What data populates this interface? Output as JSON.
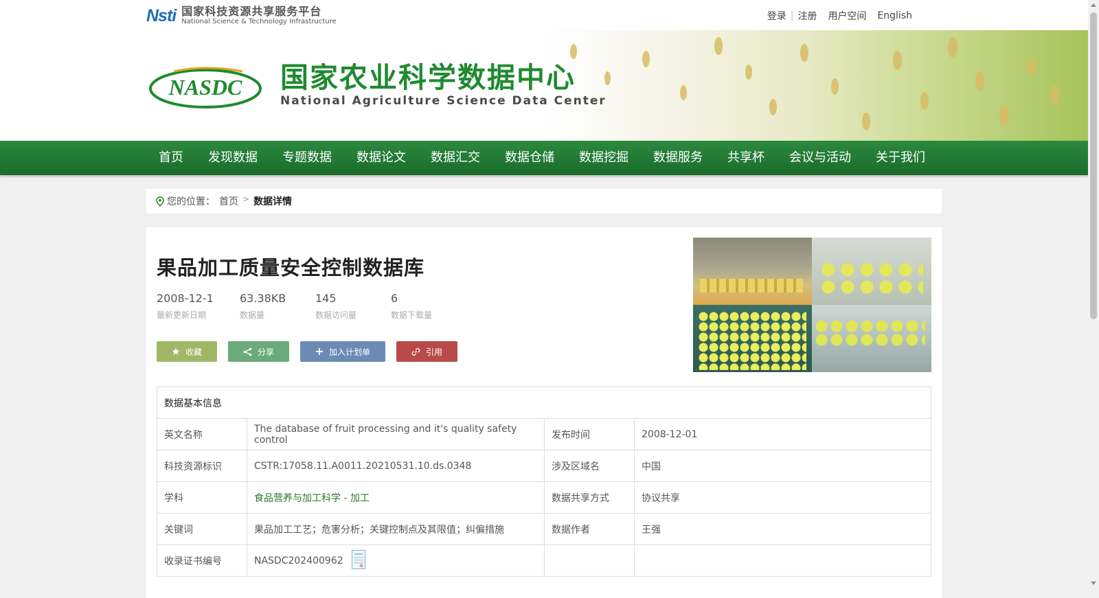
{
  "header": {
    "nsti_logo": {
      "mark": "Nsti",
      "cn": "国家科技资源共享服务平台",
      "en": "National Science & Technology Infrastructure"
    },
    "links": {
      "login": "登录",
      "register": "注册",
      "user_space": "用户空间",
      "english": "English"
    }
  },
  "banner": {
    "logo_text": "NASDC",
    "title_cn": "国家农业科学数据中心",
    "title_en": "National Agriculture Science Data Center"
  },
  "nav": [
    "首页",
    "发现数据",
    "专题数据",
    "数据论文",
    "数据汇交",
    "数据仓储",
    "数据挖掘",
    "数据服务",
    "共享杯",
    "会议与活动",
    "关于我们"
  ],
  "breadcrumb": {
    "label": "您的位置：",
    "home": "首页",
    "current": "数据详情"
  },
  "dataset": {
    "title": "果品加工质量安全控制数据库",
    "stats": [
      {
        "value": "2008-12-1",
        "label": "最新更新日期"
      },
      {
        "value": "63.38KB",
        "label": "数据量"
      },
      {
        "value": "145",
        "label": "数据访问量"
      },
      {
        "value": "6",
        "label": "数据下载量"
      }
    ],
    "buttons": {
      "favorite": "收藏",
      "share": "分享",
      "add_plan": "加入计划单",
      "cite": "引用"
    }
  },
  "info_table": {
    "header": "数据基本信息",
    "rows": [
      {
        "label1": "英文名称",
        "value1": "The database of fruit processing and it's quality safety control",
        "label2": "发布时间",
        "value2": "2008-12-01"
      },
      {
        "label1": "科技资源标识",
        "value1": "CSTR:17058.11.A0011.20210531.10.ds.0348",
        "label2": "涉及区域名",
        "value2": "中国"
      },
      {
        "label1": "学科",
        "subject_main": "食品营养与加工科学",
        "subject_dash": " - ",
        "subject_sub": "加工",
        "label2": "数据共享方式",
        "value2": "协议共享"
      },
      {
        "label1": "关键词",
        "value1": "果品加工工艺；危害分析；关键控制点及其限值；纠偏措施",
        "label2": "数据作者",
        "value2": "王强"
      },
      {
        "label1": "收录证书编号",
        "value1": "NASDC202400962",
        "label2": "",
        "value2": ""
      }
    ]
  },
  "colors": {
    "nav_green": "#1f7a34",
    "btn_favorite": "#9fb865",
    "btn_share": "#6bab7b",
    "btn_plan": "#6b8bb5",
    "btn_cite": "#b94a4a",
    "link_green": "#2a7a2a"
  },
  "icons": {
    "location": "location-pin-icon",
    "favorite": "star-icon",
    "share": "share-icon",
    "plan": "plus-icon",
    "cite": "link-icon",
    "certificate": "certificate-icon"
  }
}
